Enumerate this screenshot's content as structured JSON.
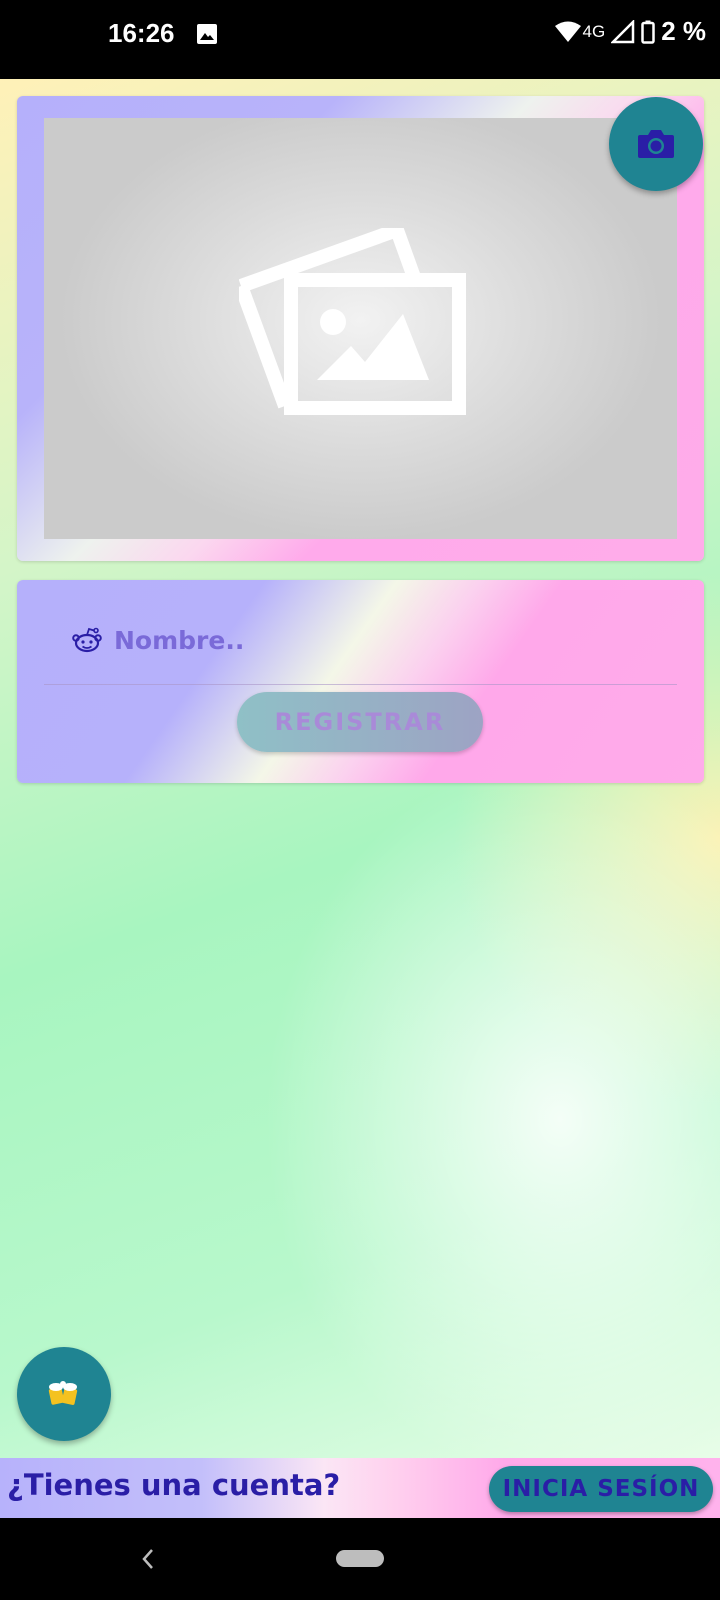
{
  "status_bar": {
    "time": "16:26",
    "network": "4G",
    "battery": "2 %",
    "icons": [
      "image-icon",
      "wifi-icon",
      "signal-icon",
      "battery-icon"
    ]
  },
  "image_card": {
    "placeholder_icon": "photo-placeholder-icon",
    "camera_button_icon": "camera-icon"
  },
  "form": {
    "name_placeholder": "Nombre..",
    "name_value": "",
    "name_icon": "reddit-alien-icon",
    "register_label": "REGISTRAR"
  },
  "fab": {
    "icon": "beer-mugs-icon"
  },
  "account_bar": {
    "prompt": "¿Tienes una cuenta?",
    "login_label": "INICIA SESÍON"
  },
  "colors": {
    "accent_teal": "#1f8492",
    "text_indigo": "#2a1ea6",
    "lavender": "#b5b0fb",
    "pink": "#ffa8ea"
  }
}
